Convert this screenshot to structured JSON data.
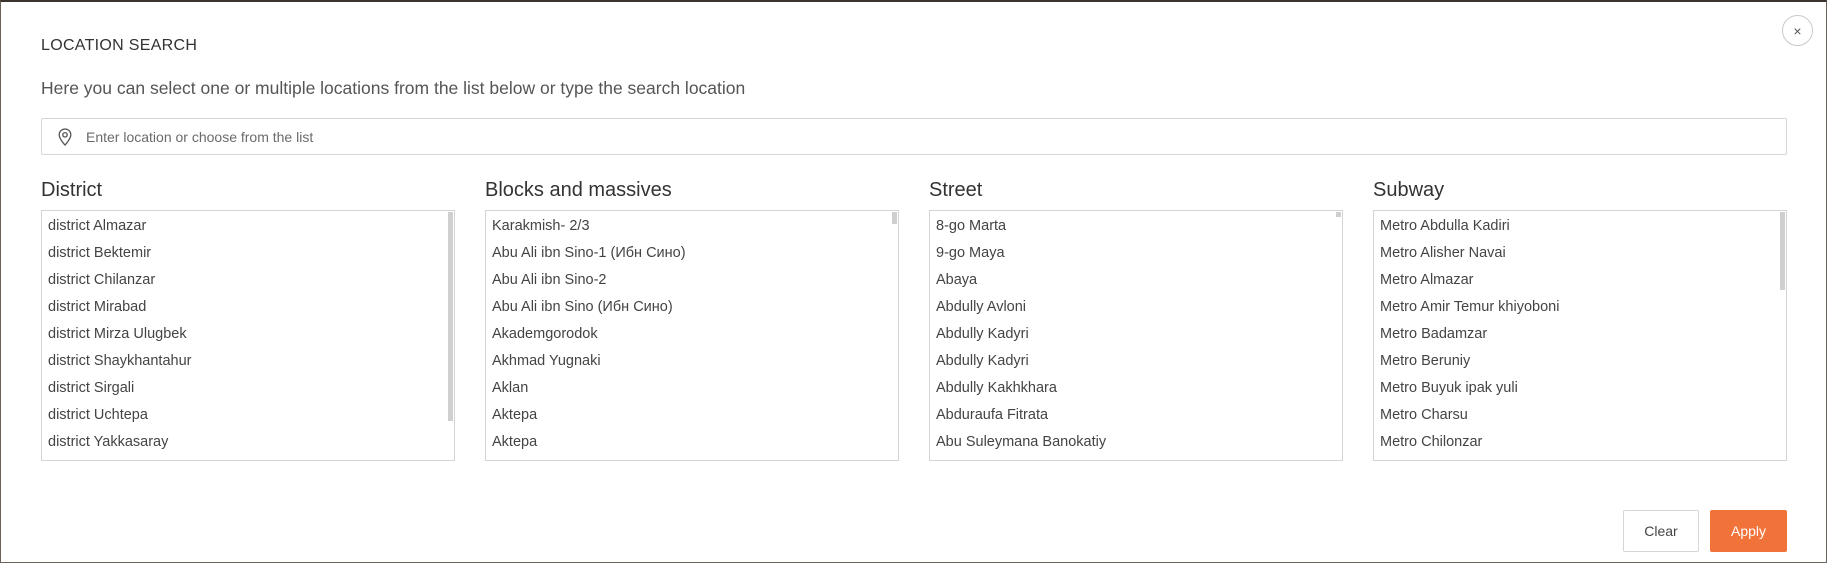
{
  "dialog": {
    "title": "LOCATION SEARCH",
    "subtitle": "Here you can select one or multiple locations from the list below or type the search location",
    "close_label": "×"
  },
  "search": {
    "placeholder": "Enter location or choose from the list",
    "value": "",
    "icon": "map-pin-icon"
  },
  "columns": [
    {
      "title": "District",
      "items": [
        "district Almazar",
        "district Bektemir",
        "district Chilanzar",
        "district Mirabad",
        "district Mirza Ulugbek",
        "district Shaykhantahur",
        "district Sirgali",
        "district Uchtepa",
        "district Yakkasaray"
      ]
    },
    {
      "title": "Blocks and massives",
      "items": [
        "Karakmish- 2/3",
        "Abu Ali ibn Sino-1 (Ибн Сино)",
        "Abu Ali ibn Sino-2",
        "Abu Ali ibn Sino (Ибн Сино)",
        "Akademgorodok",
        "Akhmad Yugnaki",
        "Aklan",
        "Aktepa",
        "Aktepa"
      ]
    },
    {
      "title": "Street",
      "items": [
        "8-go Marta",
        "9-go Maya",
        "Abaya",
        "Abdully Avloni",
        "Abdully Kadyri",
        "Abdully Kadyri",
        "Abdully Kakhkhara",
        "Abduraufa Fitrata",
        "Abu Suleymana Banokatiy"
      ]
    },
    {
      "title": "Subway",
      "items": [
        "Metro Abdulla Kadiri",
        "Metro Alisher Navai",
        "Metro Almazar",
        "Metro Amir Temur khiyoboni",
        "Metro Badamzar",
        "Metro Beruniy",
        "Metro Buyuk ipak yuli",
        "Metro Charsu",
        "Metro Chilonzar"
      ]
    }
  ],
  "footer": {
    "clear_label": "Clear",
    "apply_label": "Apply"
  },
  "colors": {
    "accent": "#f2733a",
    "border": "#d4d4d4",
    "text": "#444444"
  }
}
